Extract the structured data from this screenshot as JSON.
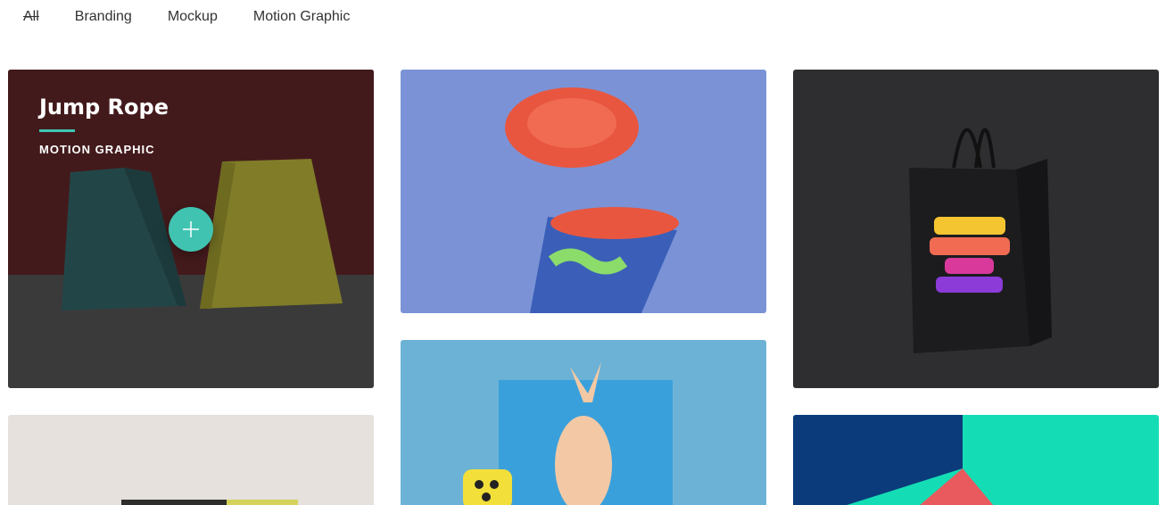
{
  "filters": [
    {
      "label": "All",
      "active": true
    },
    {
      "label": "Branding",
      "active": false
    },
    {
      "label": "Mockup",
      "active": false
    },
    {
      "label": "Motion Graphic",
      "active": false
    }
  ],
  "portfolio": {
    "hovered_item": {
      "title": "Jump Rope",
      "category": "MOTION GRAPHIC",
      "action_icon": "plus-icon"
    },
    "items": [
      {
        "image": "business-card-mockup",
        "colors": {
          "bg": "#4a1c1e",
          "card_teal": "#2f6f73",
          "card_yellow": "#d9d23a"
        }
      },
      {
        "image": "paper-hot-cup-mockup",
        "colors": {
          "bg": "#7b93d6",
          "lid": "#e8563f"
        }
      },
      {
        "image": "gravity-shopping-bag-mockup",
        "colors": {
          "bg": "#2e2e31",
          "bag": "#1c1c1e"
        }
      },
      {
        "image": "stationery-mockup",
        "colors": {
          "bg": "#e6e1dc"
        }
      },
      {
        "image": "paper-brand-pineapple-mockup",
        "colors": {
          "bg": "#6cb2d6",
          "box": "#3aa0db"
        }
      },
      {
        "image": "geometric-colors-mockup",
        "colors": {
          "teal": "#14ddb5",
          "navy": "#0b3b7a",
          "coral": "#e85a5e"
        }
      }
    ]
  },
  "accent_color": "#40c4b1"
}
